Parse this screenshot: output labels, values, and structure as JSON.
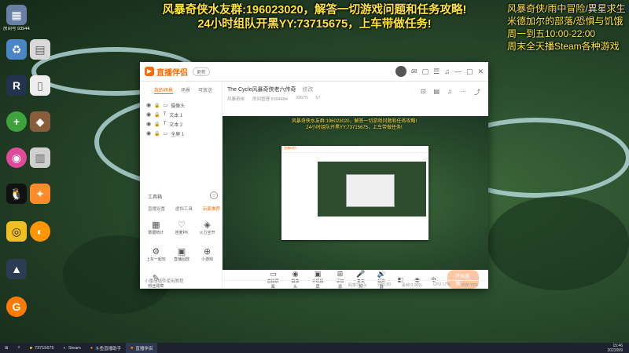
{
  "overlay": {
    "line1": "风暴奇侠水友群:196023020，解答一切游戏问题和任务攻略!",
    "line2": "24小时组队开黑YY:73715675，上车带做任务!",
    "right1": "风暴奇侠/雨中冒险/異星求生",
    "right2": "米德加尔的部落/恐惧与饥饿",
    "right3": "周一到五10:00-22:00",
    "right4": "周末全天播Steam各种游戏"
  },
  "desktop_icons": [
    {
      "label": "房间号 9394484",
      "glyph": "▦",
      "color": "#6a7fa6"
    },
    {
      "label": "",
      "glyph": "♻",
      "color": "#4a86c5"
    },
    {
      "label": "",
      "glyph": "▤",
      "color": "#d9d9d9"
    },
    {
      "label": "",
      "glyph": "R",
      "color": "#23324e"
    },
    {
      "label": "",
      "glyph": "▯",
      "color": "#eeeeee"
    },
    {
      "label": "",
      "glyph": "+",
      "color": "#3ea33c"
    },
    {
      "label": "",
      "glyph": "◆",
      "color": "#8a5d3a"
    },
    {
      "label": "",
      "glyph": "◉",
      "color": "#e04a9a"
    },
    {
      "label": "",
      "glyph": "▥",
      "color": "#cfcfcf"
    },
    {
      "label": "",
      "glyph": "🐧",
      "color": "#111111"
    },
    {
      "label": "",
      "glyph": "✦",
      "color": "#ff8a2a"
    },
    {
      "label": "",
      "glyph": "◎",
      "color": "#f0c020"
    },
    {
      "label": "",
      "glyph": "◐",
      "color": "#ff9500"
    },
    {
      "label": "",
      "glyph": "▲",
      "color": "#2b3a55"
    },
    {
      "label": "",
      "glyph": "G",
      "color": "#ff7a00"
    }
  ],
  "app": {
    "logo": "直播伴侣",
    "badge": "更新",
    "left_tabs": [
      "我的场景",
      "场景",
      "可放送"
    ],
    "scenes": [
      "摄像头",
      "文本 1",
      "文本 2",
      "全屏 1"
    ],
    "tools_title": "工具箱",
    "tools_tabs": [
      "直播设置",
      "虚拟工具",
      "玩家推荐"
    ],
    "tools": [
      {
        "glyph": "▦",
        "label": "数据统计"
      },
      {
        "glyph": "♡",
        "label": "连麦PK"
      },
      {
        "glyph": "◈",
        "label": "火力全开"
      },
      {
        "glyph": "⚙",
        "label": "上车一起玩"
      },
      {
        "glyph": "▣",
        "label": "直播回放"
      },
      {
        "glyph": "⊕",
        "label": "小游戏"
      },
      {
        "glyph": "✎",
        "label": "粉丝勋章"
      }
    ],
    "left_footer": "小番茄插件使用教程",
    "room_title": "The Cycle风暴奇侠老六传奇",
    "room_sub": "修改",
    "meta": [
      "风暴奇侠",
      "房间管理 9394484",
      "33675",
      "57"
    ],
    "preview_overlay1": "风暴奇侠水友群:196023020，解答一切游戏问题和任务攻略!",
    "preview_overlay2": "24小时组队开黑YY:73715675，上车带做任务!",
    "controls": [
      {
        "glyph": "▭",
        "label": "直播屏幕"
      },
      {
        "glyph": "◉",
        "label": "摄像头"
      },
      {
        "glyph": "▣",
        "label": "手机投屏"
      },
      {
        "glyph": "⊞",
        "label": "添加源"
      },
      {
        "glyph": "🎤",
        "label": "麦克风"
      },
      {
        "glyph": "🔊",
        "label": "扬声器"
      }
    ],
    "live_button": "开始直播",
    "status": [
      "码率:0kb/s",
      "FPS:60",
      "丢帧:0.00%",
      "CPU:17%",
      "内存:75%"
    ]
  },
  "taskbar": {
    "items": [
      "73715675",
      "Steam",
      "斗鱼直播助手",
      "直播伴侣"
    ],
    "time": "15:46",
    "date": "2022/8/9"
  }
}
